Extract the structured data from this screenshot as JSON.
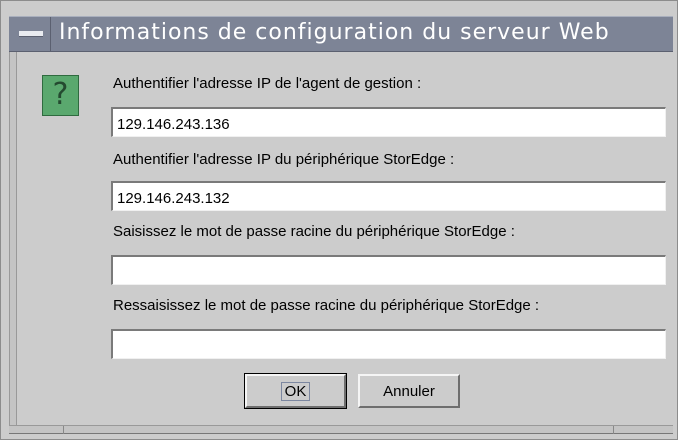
{
  "window": {
    "title": "Informations de configuration du serveur Web"
  },
  "icons": {
    "window_menu": "minus-bar-icon",
    "dialog": "question-mark-icon",
    "dialog_glyph": "?"
  },
  "form": {
    "agent_ip_label": "Authentifier l'adresse IP de l'agent de gestion :",
    "agent_ip_value": "129.146.243.136",
    "device_ip_label": "Authentifier l'adresse IP du périphérique StorEdge :",
    "device_ip_value": "129.146.243.132",
    "root_password_label": "Saisissez le mot de passe racine du périphérique StorEdge :",
    "root_password_value": "",
    "root_password_confirm_label": "Ressaisissez le mot de passe racine du périphérique StorEdge :",
    "root_password_confirm_value": ""
  },
  "buttons": {
    "ok_label": "OK",
    "cancel_label": "Annuler"
  },
  "colors": {
    "titlebar": "#7d8496",
    "dialog_bg": "#cccccc",
    "icon_green": "#5aa86e"
  }
}
